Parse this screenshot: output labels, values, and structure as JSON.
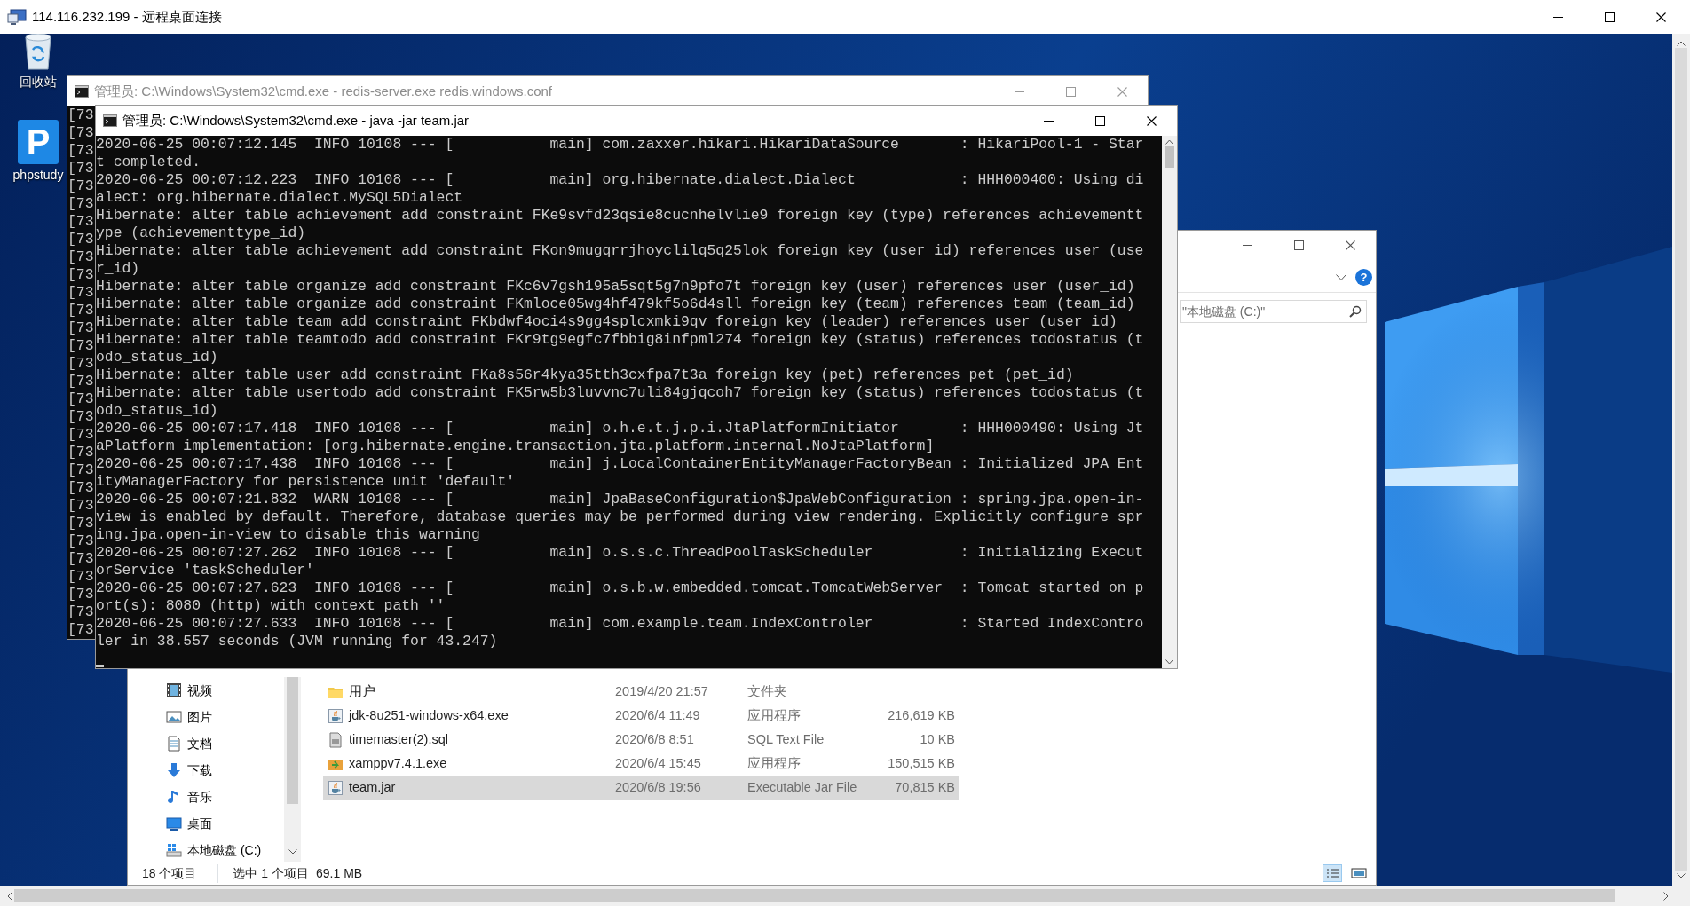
{
  "remote_desktop": {
    "title": "114.116.232.199 - 远程桌面连接"
  },
  "desktop_icons": [
    {
      "label": "回收站",
      "kind": "recycle-bin"
    },
    {
      "label": "phpstudy",
      "kind": "app-logo",
      "logo_text": "P"
    }
  ],
  "redis_console": {
    "title": "管理员: C:\\Windows\\System32\\cmd.exe - redis-server.exe  redis.windows.conf",
    "active": false,
    "lines": [
      "[73",
      "[73",
      "[73",
      "[73",
      "[73",
      "[73",
      "[73",
      "[73",
      "[73",
      "[73",
      "[73",
      "[73",
      "[73",
      "[73",
      "[73",
      "[73",
      "[73",
      "[73",
      "[73",
      "[73",
      "[73",
      "[73",
      "[73",
      "[73",
      "[73",
      "[73",
      "[73",
      "[73",
      "[73",
      "[73"
    ]
  },
  "java_console": {
    "title": "管理员: C:\\Windows\\System32\\cmd.exe - java  -jar team.jar",
    "active": true,
    "cursor_visible": true,
    "lines": [
      "2020-06-25 00:07:12.145  INFO 10108 --- [           main] com.zaxxer.hikari.HikariDataSource       : HikariPool-1 - Star",
      "t completed.",
      "2020-06-25 00:07:12.223  INFO 10108 --- [           main] org.hibernate.dialect.Dialect            : HHH000400: Using di",
      "alect: org.hibernate.dialect.MySQL5Dialect",
      "Hibernate: alter table achievement add constraint FKe9svfd23qsie8cucnhelvlie9 foreign key (type) references achievementt",
      "ype (achievementtype_id)",
      "Hibernate: alter table achievement add constraint FKon9mugqrrjhoyclilq5q25lok foreign key (user_id) references user (use",
      "r_id)",
      "Hibernate: alter table organize add constraint FKc6v7gsh195a5sqt5g7n9pfo7t foreign key (user) references user (user_id)",
      "Hibernate: alter table organize add constraint FKmloce05wg4hf479kf5o6d4sll foreign key (team) references team (team_id)",
      "Hibernate: alter table team add constraint FKbdwf4oci4s9gg4splcxmki9qv foreign key (leader) references user (user_id)",
      "Hibernate: alter table teamtodo add constraint FKr9tg9egfc7fbbig8infpml274 foreign key (status) references todostatus (t",
      "odo_status_id)",
      "Hibernate: alter table user add constraint FKa8s56r4kya35tth3cxfpa7t3a foreign key (pet) references pet (pet_id)",
      "Hibernate: alter table usertodo add constraint FK5rw5b3luvvnc7uli84gjqcoh7 foreign key (status) references todostatus (t",
      "odo_status_id)",
      "2020-06-25 00:07:17.418  INFO 10108 --- [           main] o.h.e.t.j.p.i.JtaPlatformInitiator       : HHH000490: Using Jt",
      "aPlatform implementation: [org.hibernate.engine.transaction.jta.platform.internal.NoJtaPlatform]",
      "2020-06-25 00:07:17.438  INFO 10108 --- [           main] j.LocalContainerEntityManagerFactoryBean : Initialized JPA Ent",
      "ityManagerFactory for persistence unit 'default'",
      "2020-06-25 00:07:21.832  WARN 10108 --- [           main] JpaBaseConfiguration$JpaWebConfiguration : spring.jpa.open-in-",
      "view is enabled by default. Therefore, database queries may be performed during view rendering. Explicitly configure spr",
      "ing.jpa.open-in-view to disable this warning",
      "2020-06-25 00:07:27.262  INFO 10108 --- [           main] o.s.s.c.ThreadPoolTaskScheduler          : Initializing Execut",
      "orService 'taskScheduler'",
      "2020-06-25 00:07:27.623  INFO 10108 --- [           main] o.s.b.w.embedded.tomcat.TomcatWebServer  : Tomcat started on p",
      "ort(s): 8080 (http) with context path ''",
      "2020-06-25 00:07:27.633  INFO 10108 --- [           main] com.example.team.IndexControler          : Started IndexContro",
      "ler in 38.557 seconds (JVM running for 43.247)"
    ]
  },
  "explorer": {
    "help_button": "?",
    "search": {
      "placeholder": "\"本地磁盘 (C:)\""
    },
    "sidebar": [
      {
        "label": "视频",
        "kind": "videos"
      },
      {
        "label": "图片",
        "kind": "pictures"
      },
      {
        "label": "文档",
        "kind": "documents"
      },
      {
        "label": "下载",
        "kind": "downloads"
      },
      {
        "label": "音乐",
        "kind": "music"
      },
      {
        "label": "桌面",
        "kind": "desktop"
      },
      {
        "label": "本地磁盘 (C:)",
        "kind": "drive"
      }
    ],
    "files": [
      {
        "name": "用户",
        "date": "2019/4/20 21:57",
        "type": "文件夹",
        "kind": "folder",
        "selected": false
      },
      {
        "name": "jdk-8u251-windows-x64.exe",
        "date": "2020/6/4 11:49",
        "type": "应用程序",
        "size": "216,619 KB",
        "kind": "java",
        "selected": false
      },
      {
        "name": "timemaster(2).sql",
        "date": "2020/6/8 8:51",
        "type": "SQL Text File",
        "size": "10 KB",
        "kind": "sql",
        "selected": false
      },
      {
        "name": "xamppv7.4.1.exe",
        "date": "2020/6/4 15:45",
        "type": "应用程序",
        "size": "150,515 KB",
        "kind": "installer",
        "selected": false
      },
      {
        "name": "team.jar",
        "date": "2020/6/8 19:56",
        "type": "Executable Jar File",
        "size": "70,815 KB",
        "kind": "java",
        "selected": true
      }
    ],
    "status_bar": {
      "item_count": "18 个项目",
      "selection": "选中 1 个项目",
      "selection_size": "69.1 MB"
    }
  }
}
